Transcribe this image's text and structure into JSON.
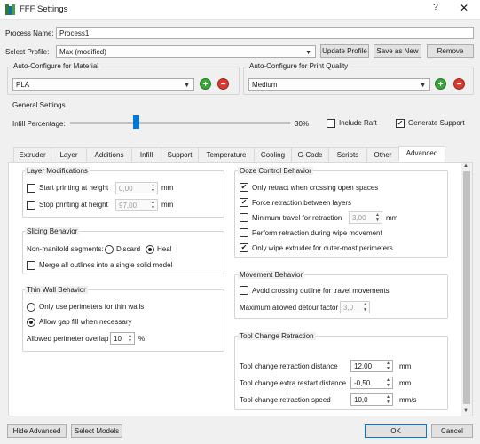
{
  "window": {
    "title": "FFF Settings",
    "help_glyph": "?",
    "close_glyph": "✕"
  },
  "process": {
    "name_label": "Process Name:",
    "name_value": "Process1",
    "profile_label": "Select Profile:",
    "profile_value": "Max (modified)",
    "update_profile": "Update Profile",
    "save_as_new": "Save as New",
    "remove": "Remove"
  },
  "auto_material": {
    "title": "Auto-Configure for Material",
    "value": "PLA"
  },
  "auto_quality": {
    "title": "Auto-Configure for Print Quality",
    "value": "Medium"
  },
  "general": {
    "title": "General Settings",
    "infill_label": "Infill Percentage:",
    "infill_value_text": "30%",
    "infill_fraction": 0.3,
    "include_raft": "Include Raft",
    "include_raft_checked": false,
    "generate_support": "Generate Support",
    "generate_support_checked": true
  },
  "tabs": [
    {
      "label": "Extruder"
    },
    {
      "label": "Layer"
    },
    {
      "label": "Additions"
    },
    {
      "label": "Infill"
    },
    {
      "label": "Support"
    },
    {
      "label": "Temperature"
    },
    {
      "label": "Cooling"
    },
    {
      "label": "G-Code"
    },
    {
      "label": "Scripts"
    },
    {
      "label": "Other"
    },
    {
      "label": "Advanced",
      "active": true
    }
  ],
  "layer_mod": {
    "title": "Layer Modifications",
    "start_label": "Start printing at height",
    "start_value": "0,00",
    "stop_label": "Stop printing at height",
    "stop_value": "97,00",
    "unit": "mm"
  },
  "slicing": {
    "title": "Slicing Behavior",
    "nonmanifold_label": "Non-manifold segments:",
    "discard": "Discard",
    "heal": "Heal",
    "merge": "Merge all outlines into a single solid model"
  },
  "thin_wall": {
    "title": "Thin Wall Behavior",
    "only_perimeters": "Only use perimeters for thin walls",
    "gap_fill": "Allow gap fill when necessary",
    "overlap_label": "Allowed perimeter overlap",
    "overlap_value": "10",
    "overlap_unit": "%"
  },
  "ooze": {
    "title": "Ooze Control Behavior",
    "only_retract": "Only retract when crossing open spaces",
    "force_retract": "Force retraction between layers",
    "min_travel": "Minimum travel for retraction",
    "min_travel_value": "3,00",
    "min_travel_unit": "mm",
    "perform_wipe": "Perform retraction during wipe movement",
    "only_wipe": "Only wipe extruder for outer-most perimeters"
  },
  "movement": {
    "title": "Movement Behavior",
    "avoid": "Avoid crossing outline for travel movements",
    "detour_label": "Maximum allowed detour factor",
    "detour_value": "3,0"
  },
  "toolchange": {
    "title": "Tool Change Retraction",
    "distance_label": "Tool change retraction distance",
    "distance_value": "12,00",
    "distance_unit": "mm",
    "restart_label": "Tool change extra restart distance",
    "restart_value": "-0,50",
    "restart_unit": "mm",
    "speed_label": "Tool change retraction speed",
    "speed_value": "10,0",
    "speed_unit": "mm/s"
  },
  "footer": {
    "hide_advanced": "Hide Advanced",
    "select_models": "Select Models",
    "ok": "OK",
    "cancel": "Cancel"
  },
  "colors": {
    "accent": "#0078d7",
    "add_green": "#3aa43a",
    "remove_red": "#d63a2e"
  }
}
